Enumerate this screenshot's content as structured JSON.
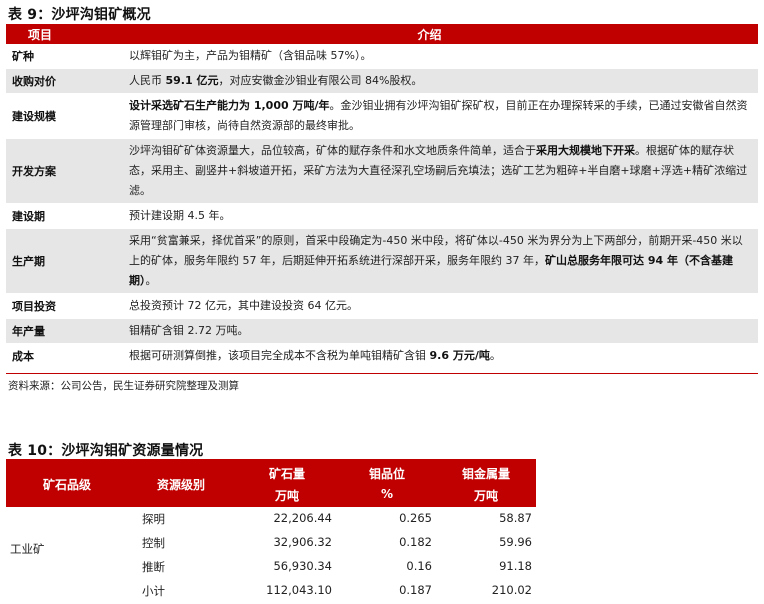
{
  "table9": {
    "caption": "表 9：沙坪沟钼矿概况",
    "headers": [
      "项目",
      "介绍"
    ],
    "rows": [
      {
        "label": "矿种",
        "parts": [
          {
            "t": "以辉钼矿为主，产品为钼精矿（含钼品味 57%）。",
            "b": false
          }
        ]
      },
      {
        "label": "收购对价",
        "parts": [
          {
            "t": "人民币 ",
            "b": false
          },
          {
            "t": "59.1 亿元",
            "b": true
          },
          {
            "t": "，对应安徽金沙钼业有限公司 84%股权。",
            "b": false
          }
        ]
      },
      {
        "label": "建设规模",
        "parts": [
          {
            "t": "设计采选矿石生产能力为 1,000 万吨/年",
            "b": true
          },
          {
            "t": "。金沙钼业拥有沙坪沟钼矿探矿权，目前正在办理探转采的手续，已通过安徽省自然资源管理部门审核，尚待自然资源部的最终审批。",
            "b": false
          }
        ]
      },
      {
        "label": "开发方案",
        "parts": [
          {
            "t": "沙坪沟钼矿矿体资源量大，品位较高，矿体的赋存条件和水文地质条件简单，适合于",
            "b": false
          },
          {
            "t": "采用大规模地下开采",
            "b": true
          },
          {
            "t": "。根据矿体的赋存状态，采用主、副竖井+斜坡道开拓，采矿方法为大直径深孔空场嗣后充填法；选矿工艺为粗碎+半自磨+球磨+浮选+精矿浓缩过滤。",
            "b": false
          }
        ]
      },
      {
        "label": "建设期",
        "parts": [
          {
            "t": "预计建设期 4.5 年。",
            "b": false
          }
        ]
      },
      {
        "label": "生产期",
        "parts": [
          {
            "t": "采用“贫富兼采，择优首采”的原则，首采中段确定为-450 米中段，将矿体以-450 米为界分为上下两部分，前期开采-450 米以上的矿体，服务年限约 57 年，后期延伸开拓系统进行深部开采，服务年限约 37 年，",
            "b": false
          },
          {
            "t": "矿山总服务年限可达 94 年（不含基建期）",
            "b": true
          },
          {
            "t": "。",
            "b": false
          }
        ]
      },
      {
        "label": "项目投资",
        "parts": [
          {
            "t": "总投资预计 72 亿元，其中建设投资 64 亿元。",
            "b": false
          }
        ]
      },
      {
        "label": "年产量",
        "parts": [
          {
            "t": "钼精矿含钼 2.72 万吨。",
            "b": false
          }
        ]
      },
      {
        "label": "成本",
        "parts": [
          {
            "t": "根据可研测算倒推，该项目完全成本不含税为单吨钼精矿含钼 ",
            "b": false
          },
          {
            "t": "9.6 万元/吨",
            "b": true
          },
          {
            "t": "。",
            "b": false
          }
        ]
      }
    ],
    "source": "资料来源：公司公告，民生证券研究院整理及测算"
  },
  "table10": {
    "caption": "表 10：沙坪沟钼矿资源量情况",
    "headers": {
      "grade": "矿石品级",
      "level": "资源级别",
      "ore_l1": "矿石量",
      "ore_l2": "万吨",
      "pos_l1": "钼品位",
      "pos_l2": "%",
      "metal_l1": "钼金属量",
      "metal_l2": "万吨"
    },
    "grade_label": "工业矿",
    "rows": [
      {
        "level": "探明",
        "ore": "22,206.44",
        "grade": "0.265",
        "metal": "58.87"
      },
      {
        "level": "控制",
        "ore": "32,906.32",
        "grade": "0.182",
        "metal": "59.96"
      },
      {
        "level": "推断",
        "ore": "56,930.34",
        "grade": "0.16",
        "metal": "91.18"
      },
      {
        "level": "小计",
        "ore": "112,043.10",
        "grade": "0.187",
        "metal": "210.02"
      }
    ]
  },
  "colors": {
    "header_bg": "#c00000",
    "row_shade": "#e6e6e6"
  }
}
